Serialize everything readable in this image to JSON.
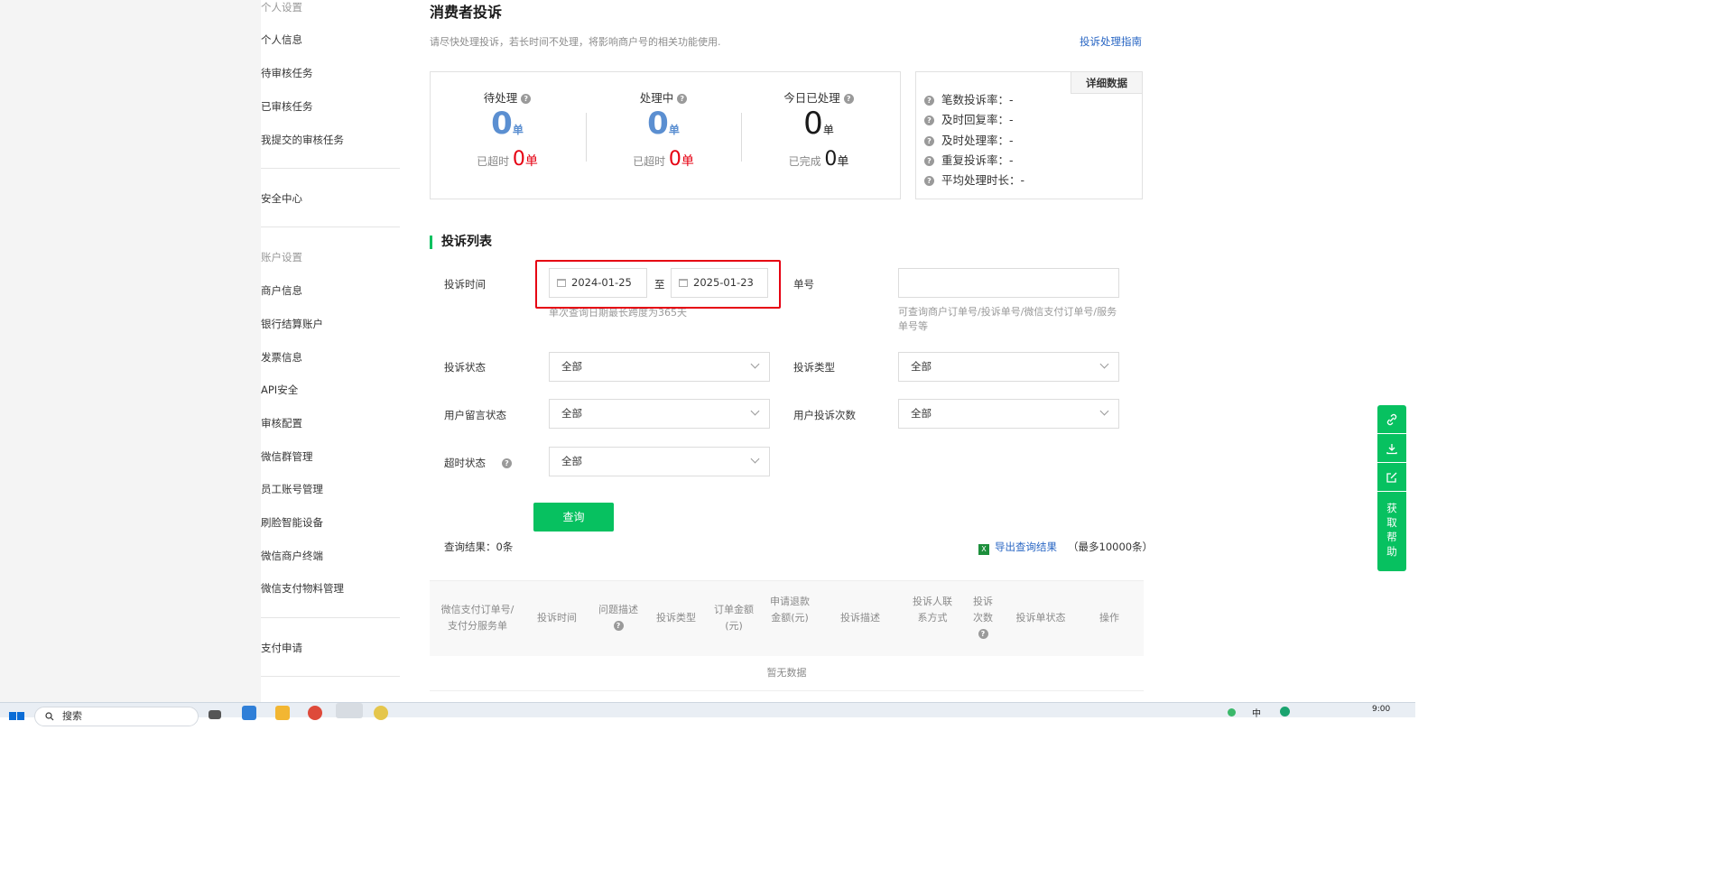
{
  "sidebar": {
    "group_personal": "个人设置",
    "personal_items": [
      "个人信息",
      "待审核任务",
      "已审核任务",
      "我提交的审核任务"
    ],
    "security": "安全中心",
    "group_account": "账户设置",
    "account_items": [
      "商户信息",
      "银行结算账户",
      "发票信息",
      "API安全",
      "审核配置",
      "微信群管理",
      "员工账号管理",
      "刷脸智能设备",
      "微信商户终端",
      "微信支付物料管理"
    ],
    "payment_apply": "支付申请"
  },
  "header": {
    "title": "消费者投诉",
    "description": "请尽快处理投诉，若长时间不处理，将影响商户号的相关功能使用.",
    "guide_link": "投诉处理指南"
  },
  "stats": {
    "unit": "单",
    "pending": {
      "label": "待处理",
      "value": "0",
      "sub_label": "已超时",
      "sub_value": "0"
    },
    "processing": {
      "label": "处理中",
      "value": "0",
      "sub_label": "已超时",
      "sub_value": "0"
    },
    "today_done": {
      "label": "今日已处理",
      "value": "0",
      "sub_label": "已完成",
      "sub_value": "0"
    },
    "colors": {
      "blue": "#5b8fd1",
      "red": "#e60012",
      "green": "#07c160"
    }
  },
  "rates": {
    "detail_button": "详细数据",
    "items": [
      "笔数投诉率：-",
      "及时回复率：-",
      "及时处理率：-",
      "重复投诉率：-",
      "平均处理时长：-"
    ]
  },
  "list": {
    "section_title": "投诉列表",
    "filters": {
      "time_label": "投诉时间",
      "date_from": "2024-01-25",
      "date_sep": "至",
      "date_to": "2025-01-23",
      "date_hint": "单次查询日期最长跨度为365天",
      "no_label": "单号",
      "no_value": "",
      "no_hint": "可查询商户订单号/投诉单号/微信支付订单号/服务单号等",
      "status_label": "投诉状态",
      "status_value": "全部",
      "type_label": "投诉类型",
      "type_value": "全部",
      "msg_label": "用户留言状态",
      "msg_value": "全部",
      "count_label": "用户投诉次数",
      "count_value": "全部",
      "timeout_label": "超时状态",
      "timeout_value": "全部"
    },
    "query_button": "查询",
    "result_text": "查询结果：0条",
    "export_link": "导出查询结果",
    "export_note": "（最多10000条）",
    "columns": [
      "微信支付订单号/支付分服务单",
      "投诉时间",
      "问题描述",
      "投诉类型",
      "订单金额(元)",
      "申请退款金额(元)",
      "投诉描述",
      "投诉人联系方式",
      "投诉次数",
      "投诉单状态",
      "操作"
    ],
    "empty_text": "暂无数据"
  },
  "float_bar": {
    "help_label": "获取帮助"
  },
  "taskbar": {
    "search_placeholder": "搜索",
    "ime": "中",
    "time": "9:00"
  }
}
